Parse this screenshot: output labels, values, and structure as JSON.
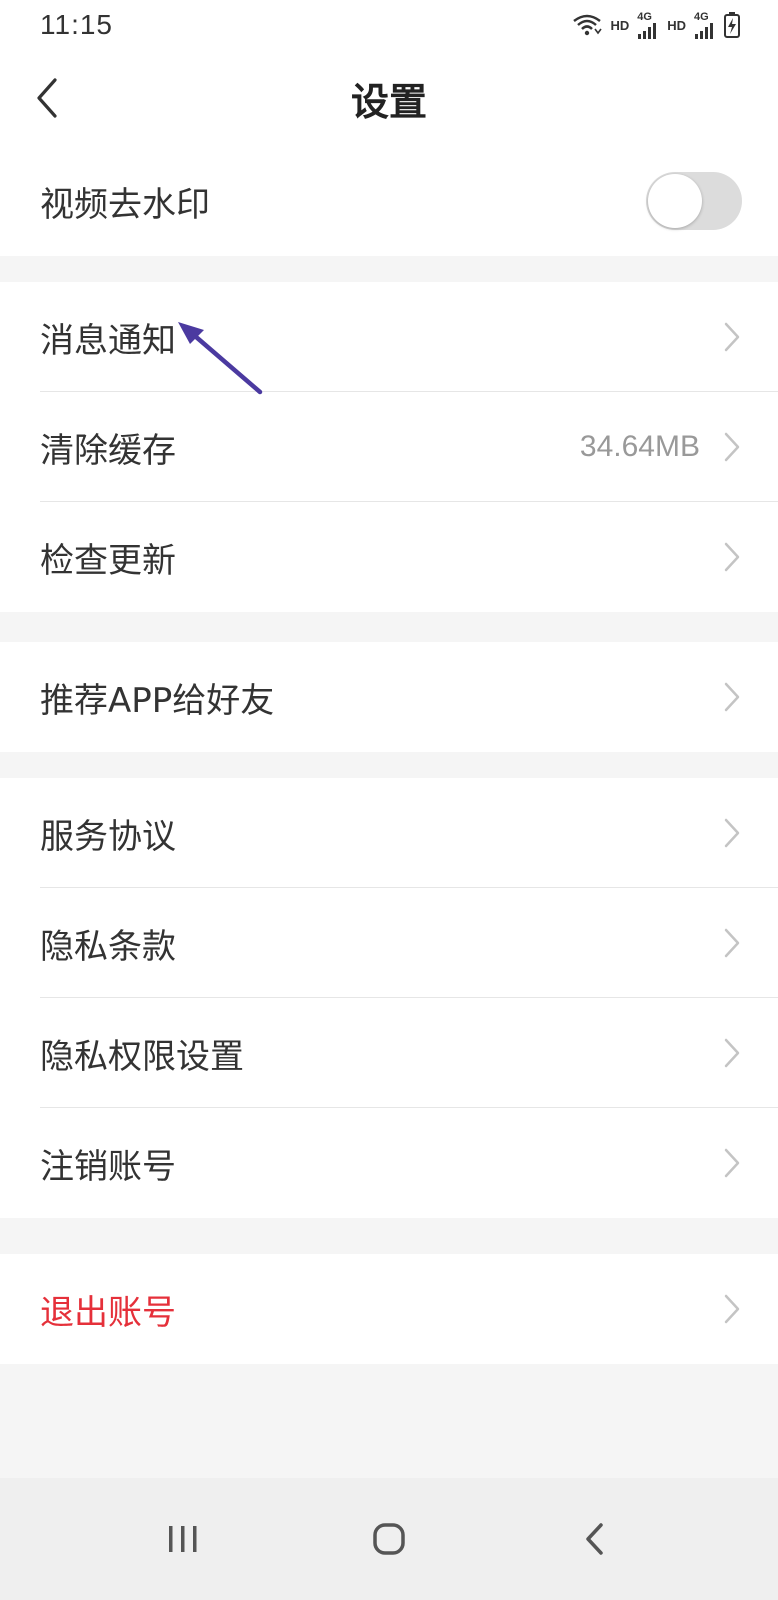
{
  "status_bar": {
    "time": "11:15",
    "hd1": "HD",
    "net1": "4G",
    "hd2": "HD",
    "net2": "4G"
  },
  "header": {
    "title": "设置"
  },
  "groups": {
    "watermark_group": {
      "video_watermark_label": "视频去水印",
      "video_watermark_enabled": false
    },
    "general_group": {
      "message_notify_label": "消息通知",
      "clear_cache_label": "清除缓存",
      "clear_cache_value": "34.64MB",
      "check_update_label": "检查更新"
    },
    "share_group": {
      "recommend_label": "推荐APP给好友"
    },
    "legal_group": {
      "service_label": "服务协议",
      "privacy_label": "隐私条款",
      "permission_label": "隐私权限设置",
      "cancel_account_label": "注销账号"
    },
    "logout_group": {
      "logout_label": "退出账号"
    }
  },
  "colors": {
    "danger": "#e5303a",
    "annotation_arrow": "#4b3aa0",
    "toggle_off": "#dcdcdc"
  },
  "icons": {
    "back": "chevron-left-icon",
    "row_arrow": "chevron-right-icon",
    "recent": "recent-apps-icon",
    "home": "home-icon",
    "back_sys": "back-icon"
  }
}
